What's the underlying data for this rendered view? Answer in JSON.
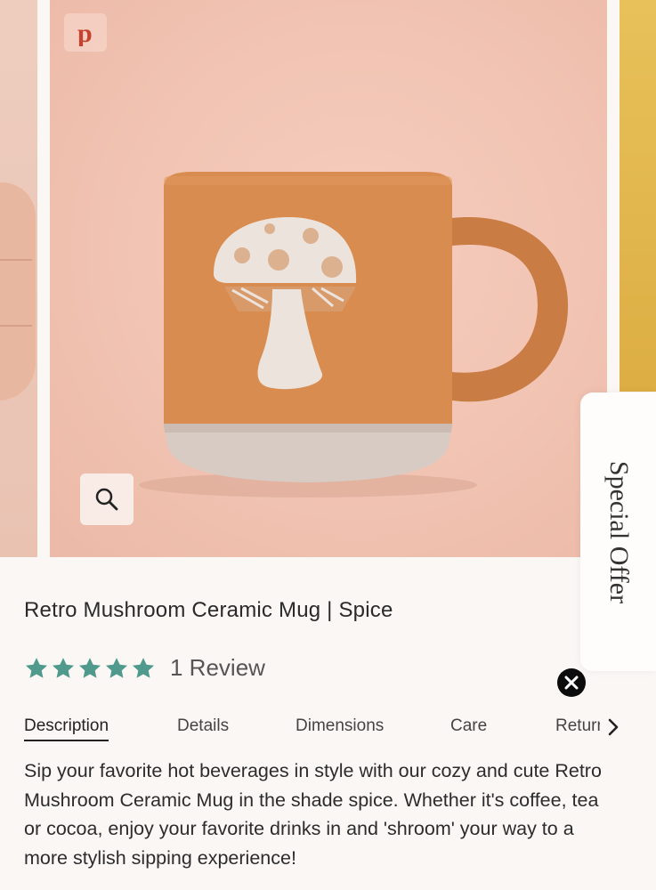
{
  "product": {
    "title": "Retro Mushroom Ceramic Mug | Spice",
    "rating_value": 5,
    "rating_max": 5,
    "review_text": "1 Review",
    "description": "Sip your favorite hot beverages in style with our cozy and cute Retro Mushroom Ceramic Mug in the shade spice. Whether it's coffee, tea or cocoa, enjoy your favorite drinks in and 'shroom' your way to a more stylish sipping experience!"
  },
  "tabs": [
    {
      "label": "Description",
      "active": true
    },
    {
      "label": "Details",
      "active": false
    },
    {
      "label": "Dimensions",
      "active": false
    },
    {
      "label": "Care",
      "active": false
    },
    {
      "label": "Returns",
      "active": false
    }
  ],
  "special_offer": {
    "label": "Special Offer"
  },
  "icons": {
    "pinterest": "pinterest-icon",
    "zoom": "search-icon",
    "close": "close-icon",
    "next": "chevron-right-icon",
    "star": "star-icon"
  },
  "colors": {
    "star": "#4f9a8c",
    "pinterest": "#c8402f",
    "mug": "#d9894c",
    "background": "#fbf7f5"
  }
}
